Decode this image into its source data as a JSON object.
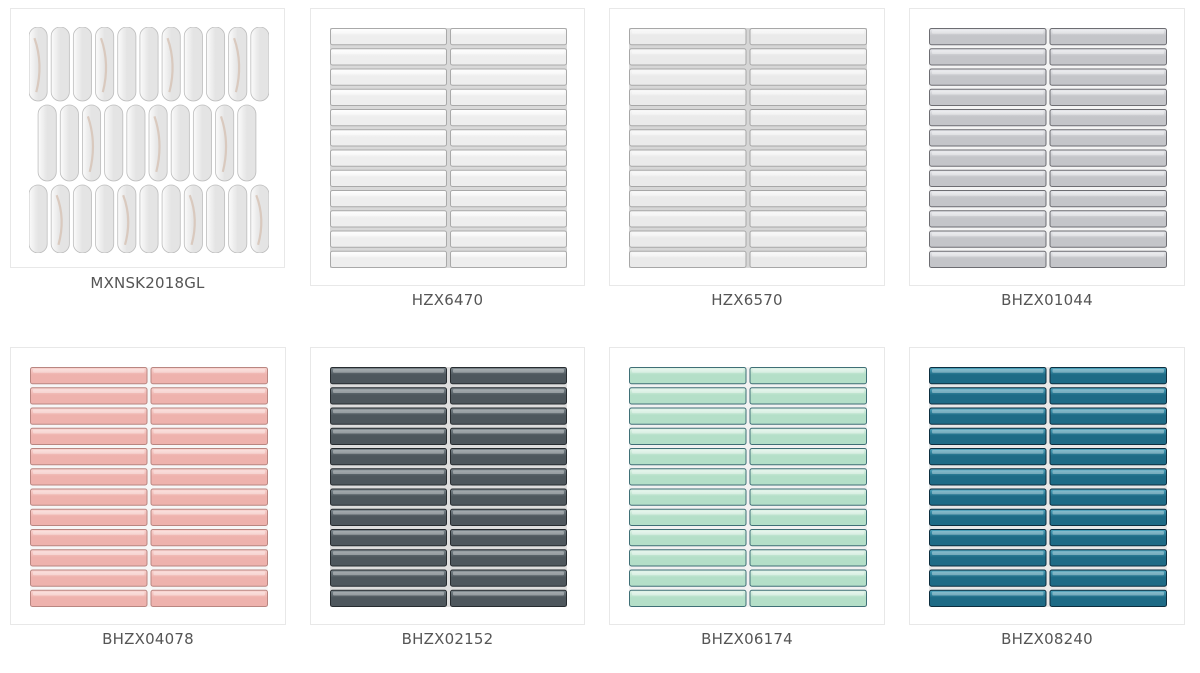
{
  "products": [
    {
      "code": "MXNSK2018GL",
      "pattern": "marble-finger",
      "colors": {
        "base": "#e4e4e4",
        "hi": "#fbfbfb",
        "vein": "#d6c2b4",
        "grout": "#ffffff",
        "edge": "#bdbdbd"
      }
    },
    {
      "code": "HZX6470",
      "pattern": "stacked-stick",
      "colors": {
        "base": "#eeeeee",
        "hi": "#ffffff",
        "grout": "#d9d9d9",
        "edge": "#a9a9a9"
      }
    },
    {
      "code": "HZX6570",
      "pattern": "stacked-stick",
      "colors": {
        "base": "#eaeaea",
        "hi": "#f8f8f8",
        "grout": "#d6d6d6",
        "edge": "#a7a7a7"
      }
    },
    {
      "code": "BHZX01044",
      "pattern": "stacked-stick",
      "colors": {
        "base": "#c4c5c9",
        "hi": "#e9eaee",
        "grout": "#f4f4f4",
        "edge": "#6d6d72"
      }
    },
    {
      "code": "BHZX04078",
      "pattern": "stacked-stick",
      "colors": {
        "base": "#eeb2ad",
        "hi": "#fad6d2",
        "grout": "#f7f7f7",
        "edge": "#b98681"
      }
    },
    {
      "code": "BHZX02152",
      "pattern": "stacked-stick",
      "colors": {
        "base": "#4e575d",
        "hi": "#7e898f",
        "grout": "#dedede",
        "edge": "#272c30"
      }
    },
    {
      "code": "BHZX06174",
      "pattern": "stacked-stick",
      "colors": {
        "base": "#b4dfc8",
        "hi": "#e3f5ea",
        "grout": "#f2f2f2",
        "edge": "#3f6f76"
      }
    },
    {
      "code": "BHZX08240",
      "pattern": "stacked-stick",
      "colors": {
        "base": "#1e6b86",
        "hi": "#4fa6bf",
        "grout": "#e8e8e8",
        "edge": "#0d2e3f"
      }
    }
  ]
}
